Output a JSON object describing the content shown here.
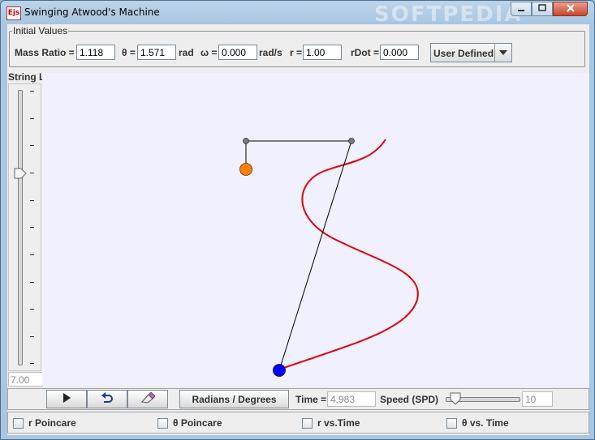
{
  "window": {
    "title": "Swinging Atwood's Machine",
    "app_icon_text": "Ejs",
    "watermark": "SOFTPEDIA"
  },
  "initial_values": {
    "group_title": "Initial Values",
    "mass_ratio": {
      "label": "Mass Ratio =",
      "value": "1.118"
    },
    "theta": {
      "label": "θ =",
      "value": "1.571",
      "unit": "rad"
    },
    "omega": {
      "label": "ω =",
      "value": "0.000",
      "unit": "rad/s"
    },
    "r": {
      "label": "r =",
      "value": "1.00"
    },
    "rdot": {
      "label": "rDot =",
      "value": "0.000"
    },
    "preset": {
      "selected": "User Defined"
    }
  },
  "string_length": {
    "label": "String L",
    "value": "7.00"
  },
  "controls": {
    "radians_degrees_label": "Radians / Degrees",
    "time_label": "Time =",
    "time_value": "4.983",
    "speed_label": "Speed (SPD)",
    "speed_value": "10"
  },
  "checkboxes": [
    {
      "label": "r Poincare"
    },
    {
      "label": "θ Poincare"
    },
    {
      "label": "r vs.Time"
    },
    {
      "label": "θ vs. Time"
    }
  ],
  "colors": {
    "trail": "#e00000",
    "small_mass": "#ff7f00",
    "large_mass": "#0000ff",
    "canvas_bg": "#f0f0ff"
  }
}
